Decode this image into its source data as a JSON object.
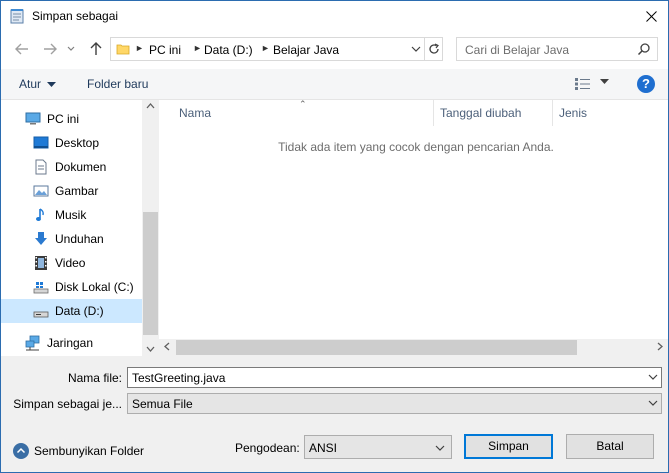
{
  "window": {
    "title": "Simpan sebagai",
    "accent": "#0078d7"
  },
  "address": {
    "crumbs": [
      "PC ini",
      "Data (D:)",
      "Belajar Java"
    ]
  },
  "search": {
    "placeholder": "Cari di Belajar Java"
  },
  "toolbar": {
    "organize_label": "Atur",
    "new_folder_label": "Folder baru",
    "help_label": "?"
  },
  "nav": {
    "items": [
      {
        "label": "PC ini",
        "icon": "pc-icon"
      },
      {
        "label": "Desktop",
        "icon": "desktop-icon"
      },
      {
        "label": "Dokumen",
        "icon": "documents-icon"
      },
      {
        "label": "Gambar",
        "icon": "pictures-icon"
      },
      {
        "label": "Musik",
        "icon": "music-icon"
      },
      {
        "label": "Unduhan",
        "icon": "downloads-icon"
      },
      {
        "label": "Video",
        "icon": "videos-icon"
      },
      {
        "label": "Disk Lokal (C:)",
        "icon": "drive-icon"
      },
      {
        "label": "Data (D:)",
        "icon": "drive-icon",
        "selected": true
      },
      {
        "label": "Jaringan",
        "icon": "network-icon"
      }
    ]
  },
  "filelist": {
    "columns": [
      "Nama",
      "Tanggal diubah",
      "Jenis"
    ],
    "empty_message": "Tidak ada item yang cocok dengan pencarian Anda."
  },
  "form": {
    "filename_label": "Nama file:",
    "filename_value": "TestGreeting.java",
    "type_label": "Simpan sebagai je...",
    "type_value": "Semua File",
    "encoding_label": "Pengodean:",
    "encoding_value": "ANSI",
    "hide_folders_label": "Sembunyikan Folder",
    "save_label": "Simpan",
    "cancel_label": "Batal"
  }
}
